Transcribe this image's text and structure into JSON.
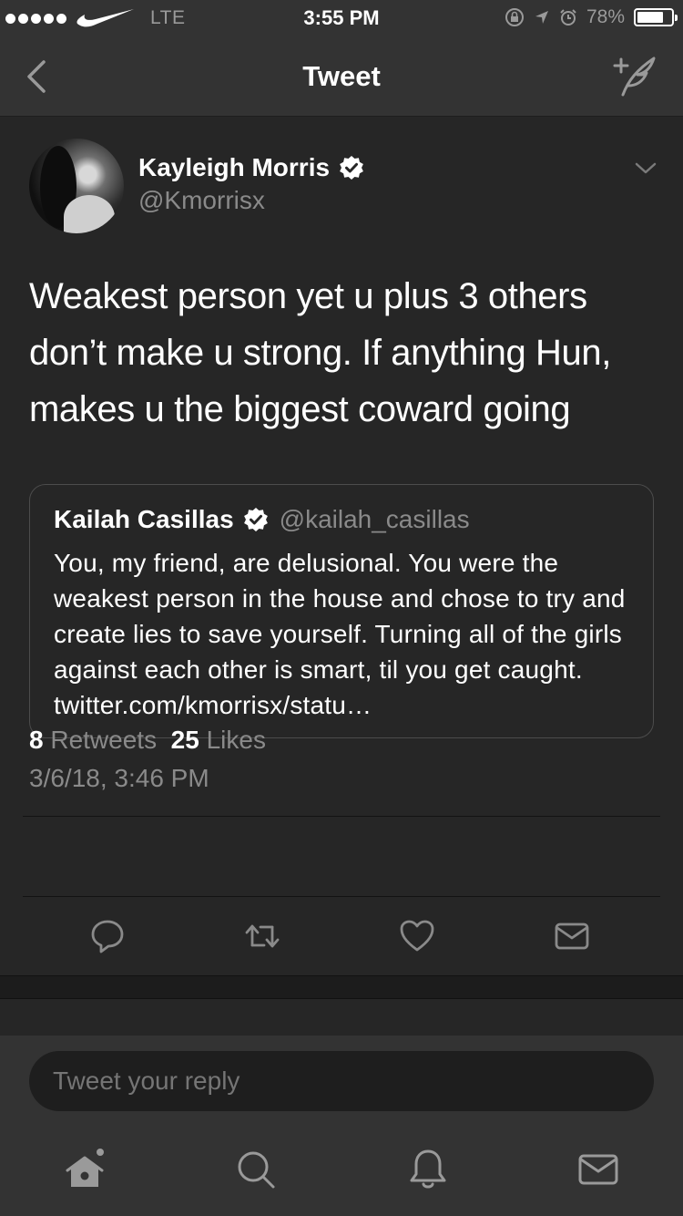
{
  "status_bar": {
    "carrier_icon": "nike-swoosh-icon",
    "network": "LTE",
    "time": "3:55 PM",
    "battery_percent": "78%",
    "battery_level": 0.78
  },
  "nav": {
    "title": "Tweet",
    "back_icon": "chevron-left-icon",
    "compose_icon": "compose-tweet-icon"
  },
  "tweet": {
    "author_name": "Kayleigh Morris",
    "author_handle": "@Kmorrisx",
    "text": "Weakest person yet u plus 3 others don’t make u strong. If anything Hun, makes u the biggest coward going",
    "quote": {
      "author_name": "Kailah Casillas",
      "author_handle": "@kailah_casillas",
      "text": "You, my friend, are delusional. You were the weakest person in the house and chose to try and create lies to save yourself. Turning all of the girls against each other is smart, til you get caught. twitter.com/kmorrisx/statu…"
    },
    "timestamp": "3/6/18, 3:46 PM",
    "retweets_count": "8",
    "retweets_label": "Retweets",
    "likes_count": "25",
    "likes_label": "Likes"
  },
  "reply": {
    "placeholder": "Tweet your reply"
  },
  "colors": {
    "background": "#262626",
    "bar": "#333333",
    "secondary_text": "#8a8a8a"
  }
}
